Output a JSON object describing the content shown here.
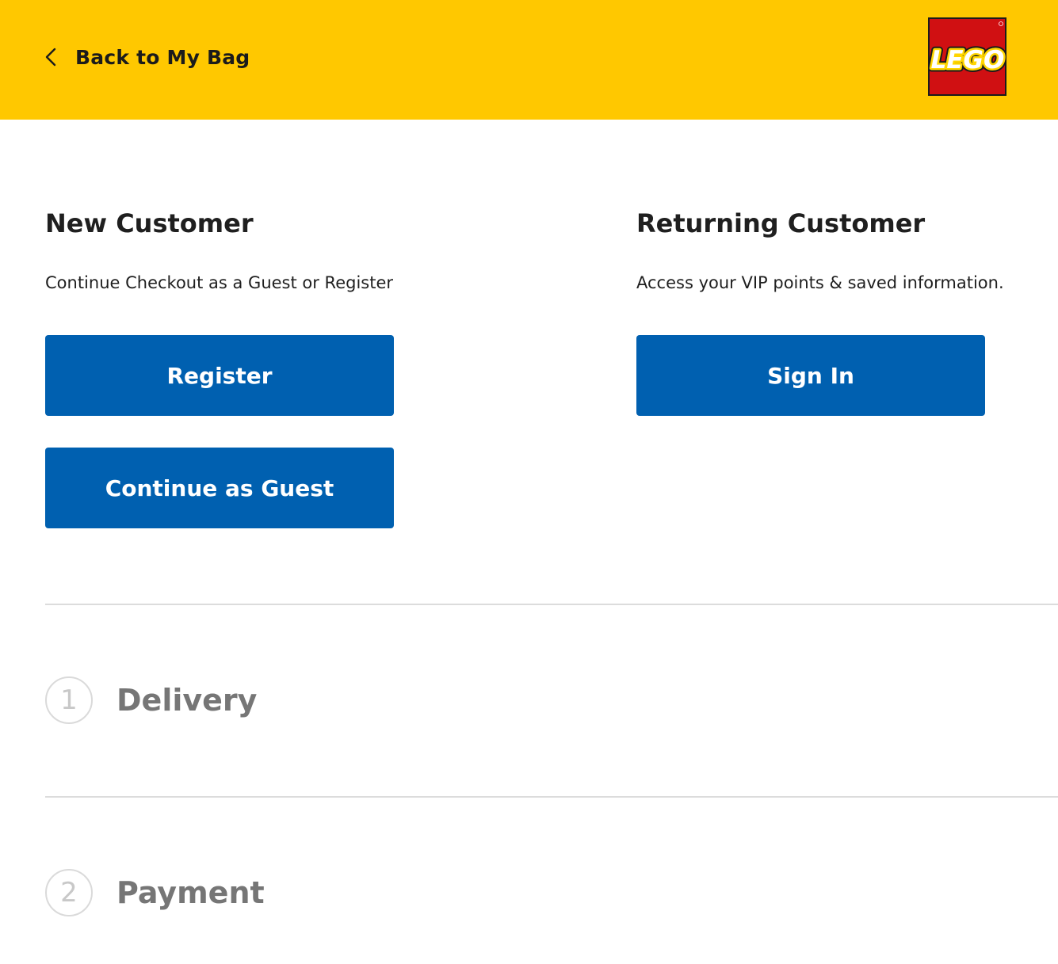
{
  "header": {
    "back_label": "Back to My Bag",
    "logo_text": "LEGO",
    "colors": {
      "background": "#ffc800",
      "logo_red": "#d01012",
      "logo_yellow": "#ffd500"
    }
  },
  "new_customer": {
    "title": "New Customer",
    "description": "Continue Checkout as a Guest or Register",
    "register_label": "Register",
    "guest_label": "Continue as Guest"
  },
  "returning_customer": {
    "title": "Returning Customer",
    "description": "Access your VIP points & saved information.",
    "sign_in_label": "Sign In"
  },
  "steps": [
    {
      "number": "1",
      "title": "Delivery"
    },
    {
      "number": "2",
      "title": "Payment"
    }
  ],
  "colors": {
    "button": "#0060b0",
    "divider": "#dcdcdc",
    "step_text": "#767676"
  }
}
